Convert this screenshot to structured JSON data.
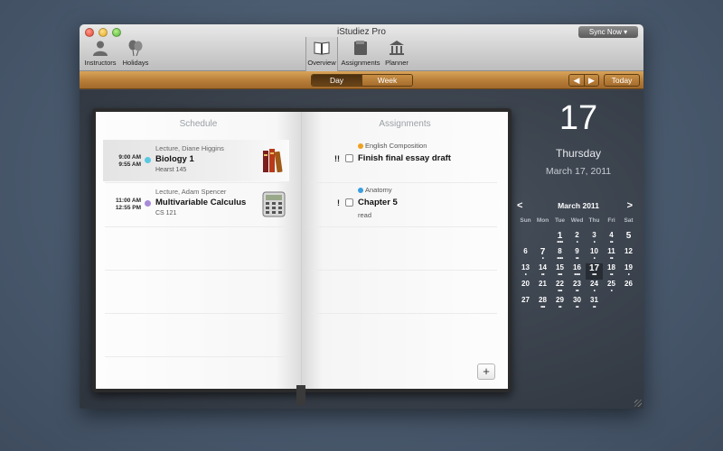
{
  "window": {
    "title": "iStudiez Pro",
    "sync_label": "Sync Now ▾"
  },
  "toolbar": {
    "left": [
      {
        "id": "instructors",
        "label": "Instructors",
        "icon": "person-icon"
      },
      {
        "id": "holidays",
        "label": "Holidays",
        "icon": "balloons-icon"
      }
    ],
    "center": [
      {
        "id": "overview",
        "label": "Overview",
        "icon": "book-icon",
        "active": true
      },
      {
        "id": "assignments",
        "label": "Assignments",
        "icon": "folder-icon",
        "active": false
      },
      {
        "id": "planner",
        "label": "Planner",
        "icon": "building-icon",
        "active": false
      }
    ]
  },
  "viewbar": {
    "day_label": "Day",
    "week_label": "Week",
    "prev": "◀",
    "next": "▶",
    "today_label": "Today"
  },
  "schedule": {
    "title": "Schedule",
    "items": [
      {
        "start": "9:00 AM",
        "end": "9:55 AM",
        "kind": "Lecture, Diane Higgins",
        "name": "Biology 1",
        "room": "Hearst 145",
        "color": "#5ac8e0",
        "icon": "books-icon"
      },
      {
        "start": "11:00 AM",
        "end": "12:55 PM",
        "kind": "Lecture, Adam Spencer",
        "name": "Multivariable Calculus",
        "room": "CS 121",
        "color": "#a78bd8",
        "icon": "calculator-icon"
      }
    ]
  },
  "assignments": {
    "title": "Assignments",
    "items": [
      {
        "priority": "!!",
        "course": "English Composition",
        "course_color": "#f0a020",
        "title": "Finish final essay draft",
        "note": ""
      },
      {
        "priority": "!",
        "course": "Anatomy",
        "course_color": "#3a9ee0",
        "title": "Chapter 5",
        "note": "read"
      }
    ],
    "add_label": "+"
  },
  "date": {
    "day": "17",
    "weekday": "Thursday",
    "full": "March 17, 2011"
  },
  "calendar": {
    "month": "March 2011",
    "prev": "<",
    "next": ">",
    "weekdays": [
      "Sun",
      "Mon",
      "Tue",
      "Wed",
      "Thu",
      "Fri",
      "Sat"
    ],
    "cells": [
      {
        "d": "",
        "dots": ""
      },
      {
        "d": "",
        "dots": ""
      },
      {
        "d": "1",
        "dots": "••••",
        "big": true
      },
      {
        "d": "2",
        "dots": "•"
      },
      {
        "d": "3",
        "dots": "•"
      },
      {
        "d": "4",
        "dots": "••"
      },
      {
        "d": "5",
        "dots": "",
        "big": true
      },
      {
        "d": "6",
        "dots": ""
      },
      {
        "d": "7",
        "dots": "•",
        "big": true
      },
      {
        "d": "8",
        "dots": "••••"
      },
      {
        "d": "9",
        "dots": "••"
      },
      {
        "d": "10",
        "dots": "•"
      },
      {
        "d": "11",
        "dots": "••"
      },
      {
        "d": "12",
        "dots": ""
      },
      {
        "d": "13",
        "dots": "•"
      },
      {
        "d": "14",
        "dots": "••"
      },
      {
        "d": "15",
        "dots": "•••"
      },
      {
        "d": "16",
        "dots": "••••"
      },
      {
        "d": "17",
        "dots": "•••",
        "today": true
      },
      {
        "d": "18",
        "dots": "••"
      },
      {
        "d": "19",
        "dots": "•"
      },
      {
        "d": "20",
        "dots": ""
      },
      {
        "d": "21",
        "dots": ""
      },
      {
        "d": "22",
        "dots": "•••"
      },
      {
        "d": "23",
        "dots": "••"
      },
      {
        "d": "24",
        "dots": "•"
      },
      {
        "d": "25",
        "dots": "•"
      },
      {
        "d": "26",
        "dots": ""
      },
      {
        "d": "27",
        "dots": ""
      },
      {
        "d": "28",
        "dots": "•••"
      },
      {
        "d": "29",
        "dots": "••"
      },
      {
        "d": "30",
        "dots": "••"
      },
      {
        "d": "31",
        "dots": "••"
      },
      {
        "d": "",
        "dots": ""
      },
      {
        "d": "",
        "dots": ""
      }
    ]
  }
}
